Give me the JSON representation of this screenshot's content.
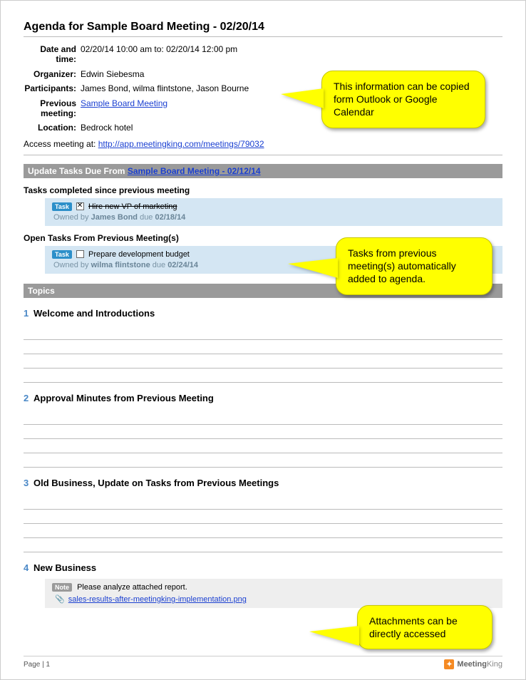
{
  "title": "Agenda for Sample Board Meeting - 02/20/14",
  "meta": {
    "datetime_label": "Date and time:",
    "datetime_value": "02/20/14 10:00 am to: 02/20/14 12:00 pm",
    "organizer_label": "Organizer:",
    "organizer_value": "Edwin Siebesma",
    "participants_label": "Participants:",
    "participants_value": "James Bond, wilma flintstone, Jason Bourne",
    "previous_label": "Previous meeting:",
    "previous_link": "Sample Board Meeting",
    "location_label": "Location:",
    "location_value": "Bedrock hotel"
  },
  "access": {
    "prefix": "Access meeting at: ",
    "url": "http://app.meetingking.com/meetings/79032"
  },
  "update_bar": {
    "prefix": "Update Tasks Due From ",
    "link": "Sample Board Meeting - 02/12/14"
  },
  "tasks_completed_head": "Tasks completed since previous meeting",
  "task1": {
    "badge": "Task",
    "title": "Hire new VP of marketing",
    "owned_prefix": "Owned by ",
    "owner": "James Bond",
    "due_prefix": "   due ",
    "due": "02/18/14"
  },
  "open_tasks_head": "Open Tasks From Previous Meeting(s)",
  "task2": {
    "badge": "Task",
    "title": "Prepare development budget",
    "owned_prefix": "Owned by ",
    "owner": "wilma flintstone",
    "due_prefix": "   due ",
    "due": "02/24/14"
  },
  "topics_label": "Topics",
  "topics": [
    {
      "num": "1",
      "title": "Welcome and Introductions"
    },
    {
      "num": "2",
      "title": "Approval Minutes from Previous Meeting"
    },
    {
      "num": "3",
      "title": "Old Business, Update on Tasks from Previous Meetings"
    },
    {
      "num": "4",
      "title": "New Business"
    }
  ],
  "note": {
    "badge": "Note",
    "text": "Please analyze attached report.",
    "attachment": "sales-results-after-meetingking-implementation.png"
  },
  "footer": {
    "page": "Page | 1",
    "brand_a": "Meeting",
    "brand_b": "King"
  },
  "callouts": {
    "c1": "This information can be copied form Outlook or Google Calendar",
    "c2": "Tasks from previous meeting(s) automatically added to agenda.",
    "c3": "Attachments can be directly accessed"
  }
}
